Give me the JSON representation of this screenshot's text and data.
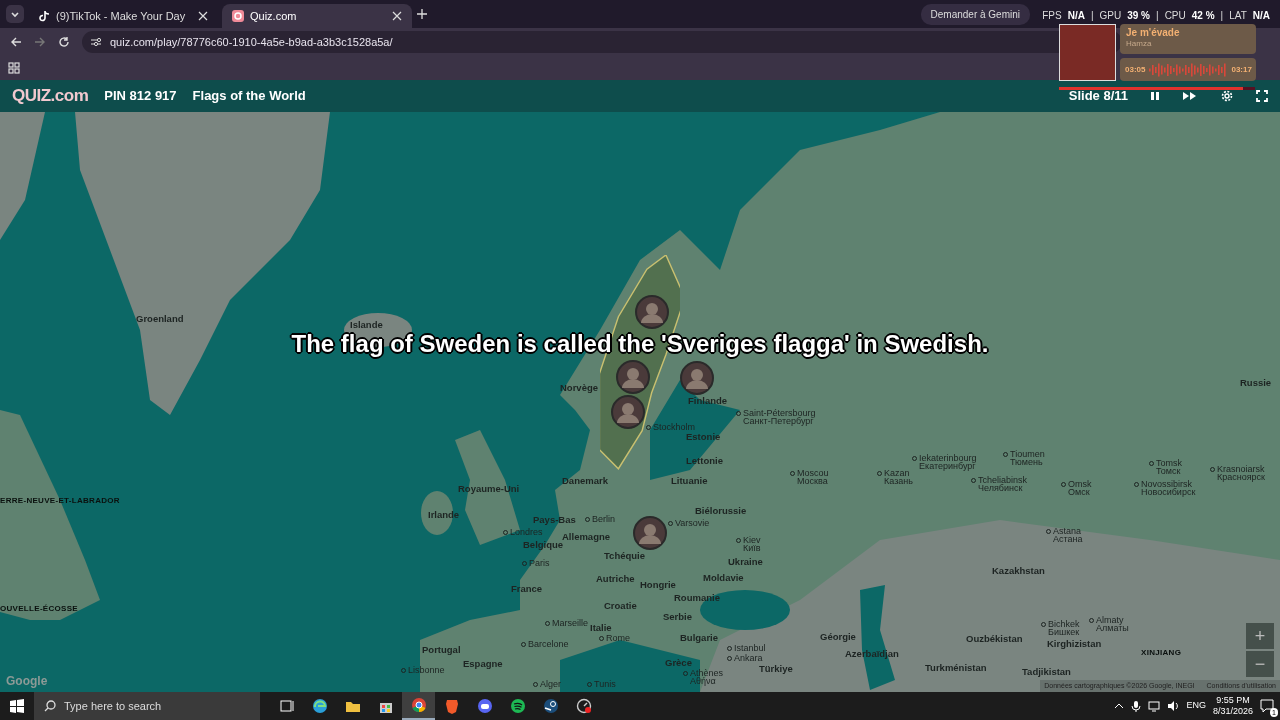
{
  "browser": {
    "tabs": [
      {
        "title": "(9)TikTok - Make Your Day",
        "selected": false
      },
      {
        "title": "Quiz.com",
        "selected": true
      }
    ],
    "url": "quiz.com/play/78776c60-1910-4a5e-b9ad-a3b3c1528a5a/"
  },
  "overlay": {
    "gemini": "Demander à Gemini",
    "separator": "|",
    "stats": [
      {
        "label": "FPS",
        "value": "N/A"
      },
      {
        "label": "GPU",
        "value": "39 %"
      },
      {
        "label": "CPU",
        "value": "42 %"
      },
      {
        "label": "LAT",
        "value": "N/A"
      }
    ]
  },
  "now_playing": {
    "title": "Je m'évade",
    "artist": "Hamza",
    "elapsed": "03:05",
    "duration": "03:17",
    "level": 0.94
  },
  "quiz": {
    "logo": "QUIZ.com",
    "pin": "PIN 812 917",
    "title": "Flags of the World",
    "slide": "Slide 8/11"
  },
  "caption": "The flag of Sweden is called the 'Sveriges flagga' in Swedish.",
  "map": {
    "labels": [
      {
        "kind": "country",
        "name": "Groenland"
      },
      {
        "kind": "country",
        "name": "Islande"
      },
      {
        "kind": "country",
        "name": "Norvège"
      },
      {
        "kind": "country",
        "name": "Danemark"
      },
      {
        "kind": "country",
        "name": "Royaume-Uni"
      },
      {
        "kind": "country",
        "name": "Irlande"
      },
      {
        "kind": "country",
        "name": "Pays-Bas"
      },
      {
        "kind": "city",
        "name": "Berlin"
      },
      {
        "kind": "city",
        "name": "Londres"
      },
      {
        "kind": "country",
        "name": "Allemagne"
      },
      {
        "kind": "country",
        "name": "Belgique"
      },
      {
        "kind": "country",
        "name": "Tchéquie"
      },
      {
        "kind": "city",
        "name": "Paris"
      },
      {
        "kind": "country",
        "name": "Autriche"
      },
      {
        "kind": "country",
        "name": "France"
      },
      {
        "kind": "country",
        "name": "Croatie"
      },
      {
        "kind": "city",
        "name": "Marseille"
      },
      {
        "kind": "country",
        "name": "Italie"
      },
      {
        "kind": "city",
        "name": "Rome"
      },
      {
        "kind": "country",
        "name": "Portugal"
      },
      {
        "kind": "city",
        "name": "Barcelone"
      },
      {
        "kind": "country",
        "name": "Espagne"
      },
      {
        "kind": "city",
        "name": "Lisbonne"
      },
      {
        "kind": "city",
        "name": "Alger"
      },
      {
        "kind": "city",
        "name": "Tunis"
      },
      {
        "kind": "region",
        "name": "ERRE-NEUVE-ET-LABRADOR"
      },
      {
        "kind": "region",
        "name": "OUVELLE-ÉCOSSE"
      },
      {
        "kind": "country",
        "name": "Finlande"
      },
      {
        "kind": "city",
        "name": "Saint-Pétersbourg",
        "local": "Санкт-Петербург"
      },
      {
        "kind": "city",
        "name": "Stockholm"
      },
      {
        "kind": "country",
        "name": "Estonie"
      },
      {
        "kind": "country",
        "name": "Lettonie"
      },
      {
        "kind": "country",
        "name": "Lituanie"
      },
      {
        "kind": "country",
        "name": "Biélorussie"
      },
      {
        "kind": "city",
        "name": "Varsovie"
      },
      {
        "kind": "city",
        "name": "Kiev",
        "local": "Київ"
      },
      {
        "kind": "country",
        "name": "Ukraine"
      },
      {
        "kind": "country",
        "name": "Hongrie"
      },
      {
        "kind": "country",
        "name": "Moldavie"
      },
      {
        "kind": "country",
        "name": "Roumanie"
      },
      {
        "kind": "country",
        "name": "Serbie"
      },
      {
        "kind": "country",
        "name": "Bulgarie"
      },
      {
        "kind": "country",
        "name": "Grèce"
      },
      {
        "kind": "city",
        "name": "Istanbul"
      },
      {
        "kind": "city",
        "name": "Ankara"
      },
      {
        "kind": "country",
        "name": "Türkiye"
      },
      {
        "kind": "city",
        "name": "Athènes",
        "local": "Αθήνα"
      },
      {
        "kind": "country",
        "name": "Géorgie"
      },
      {
        "kind": "country",
        "name": "Azerbaïdjan"
      },
      {
        "kind": "country",
        "name": "Turkménistan"
      },
      {
        "kind": "country",
        "name": "Ouzbékistan"
      },
      {
        "kind": "city",
        "name": "Bichkek",
        "local": "Бишкек"
      },
      {
        "kind": "city",
        "name": "Almaty",
        "local": "Алматы"
      },
      {
        "kind": "country",
        "name": "Kirghizistan"
      },
      {
        "kind": "country",
        "name": "Tadjikistan"
      },
      {
        "kind": "region",
        "name": "XINJIANG"
      },
      {
        "kind": "country",
        "name": "Kazakhstan"
      },
      {
        "kind": "city",
        "name": "Astana",
        "local": "Астана"
      },
      {
        "kind": "city",
        "name": "Moscou",
        "local": "Москва"
      },
      {
        "kind": "city",
        "name": "Kazan",
        "local": "Казань"
      },
      {
        "kind": "city",
        "name": "Iekaterinbourg",
        "local": "Екатеринбург"
      },
      {
        "kind": "city",
        "name": "Tcheliabinsk",
        "local": "Челябинск"
      },
      {
        "kind": "city",
        "name": "Tioumen",
        "local": "Тюмень"
      },
      {
        "kind": "city",
        "name": "Omsk",
        "local": "Омск"
      },
      {
        "kind": "city",
        "name": "Tomsk",
        "local": "Томск"
      },
      {
        "kind": "city",
        "name": "Novossibirsk",
        "local": "Новосибирск"
      },
      {
        "kind": "country",
        "name": "Russie"
      },
      {
        "kind": "city",
        "name": "Krasnoiarsk",
        "local": "Красноярск"
      }
    ],
    "attribution": "Google",
    "credits": "Données cartographiques ©2026 Google, INEGI",
    "terms": "Conditions d'utilisation",
    "zoom_in": "+",
    "zoom_out": "−"
  },
  "taskbar": {
    "search_placeholder": "Type here to search",
    "apps": [
      {
        "kind": "taskview",
        "selected": false
      },
      {
        "kind": "globe",
        "selected": false
      },
      {
        "kind": "folder",
        "selected": false
      },
      {
        "kind": "bag",
        "selected": false
      },
      {
        "kind": "chrome",
        "selected": true
      },
      {
        "kind": "shield",
        "selected": false
      },
      {
        "kind": "gamepad",
        "selected": false
      },
      {
        "kind": "music",
        "selected": false
      },
      {
        "kind": "steam",
        "selected": false
      },
      {
        "kind": "gauge",
        "selected": false
      }
    ],
    "language": "ENG",
    "time": "9:55 PM",
    "date": "8/31/2026",
    "notifications": "1"
  }
}
